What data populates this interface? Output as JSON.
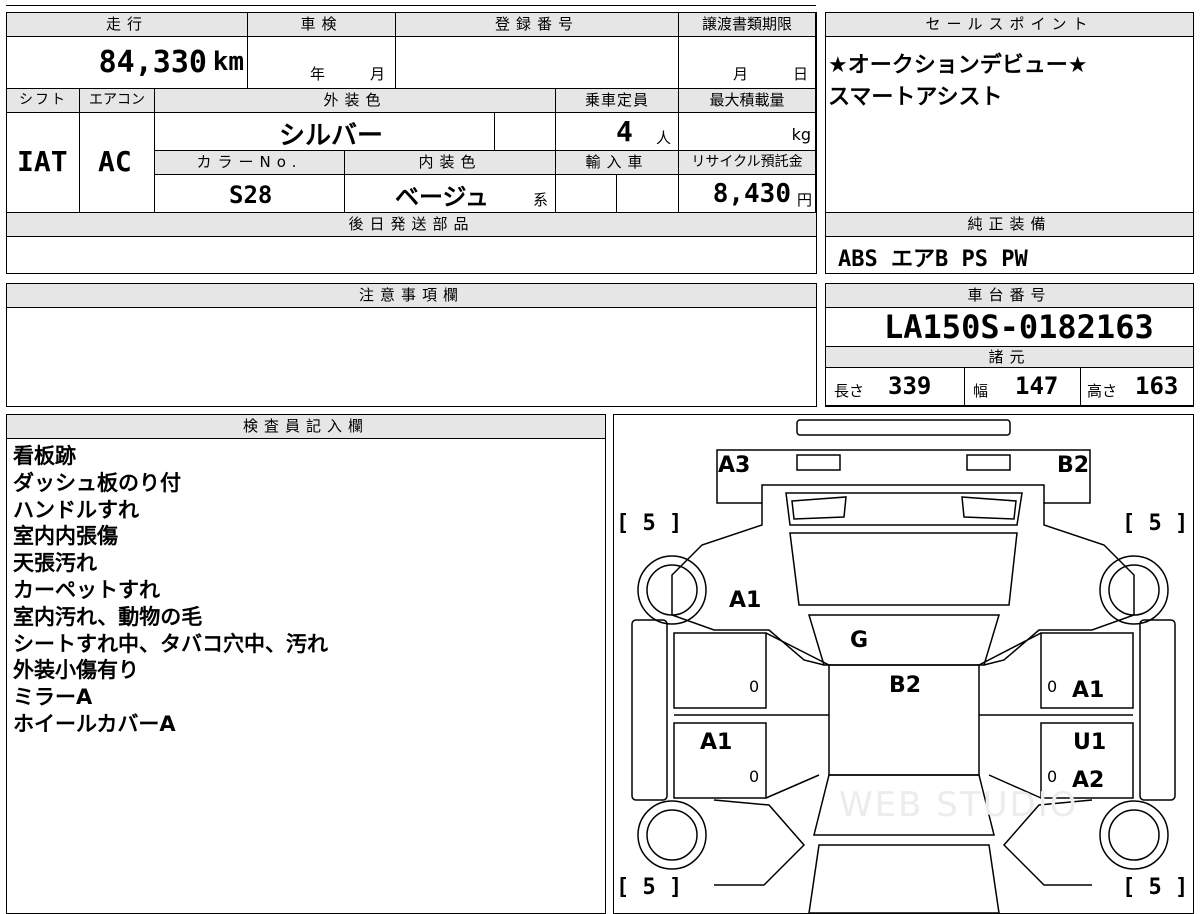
{
  "top_table": {
    "mileage": {
      "header": "走行",
      "value": "84,330",
      "unit": "km"
    },
    "inspection": {
      "header": "車検",
      "year_unit": "年",
      "month_unit": "月",
      "value": ""
    },
    "registration": {
      "header": "登録番号",
      "value": ""
    },
    "transfer_deadline": {
      "header": "譲渡書類期限",
      "month_unit": "月",
      "day_unit": "日",
      "value": ""
    },
    "shift": {
      "header": "シフト",
      "value": "IAT"
    },
    "aircon": {
      "header": "エアコン",
      "value": "AC"
    },
    "exterior_color": {
      "header": "外装色",
      "value": "シルバー"
    },
    "seating": {
      "header": "乗車定員",
      "value": "4",
      "unit": "人"
    },
    "max_load": {
      "header": "最大積載量",
      "value": "",
      "unit": "kg"
    },
    "color_no": {
      "header": "カラーNo.",
      "value": "S28"
    },
    "interior_color": {
      "header": "内装色",
      "value": "ベージュ",
      "suffix": "系"
    },
    "import": {
      "header": "輸入車",
      "value": ""
    },
    "recycle": {
      "header": "リサイクル預託金",
      "value": "8,430",
      "unit": "円"
    },
    "later_parts": {
      "header": "後日発送部品",
      "value": ""
    }
  },
  "sales_points": {
    "header": "セールスポイント",
    "lines": [
      "★オークションデビュー★",
      "スマートアシスト"
    ]
  },
  "genuine_equipment": {
    "header": "純正装備",
    "value": "ABS エアB PS PW"
  },
  "notes": {
    "header": "注意事項欄",
    "value": ""
  },
  "chassis": {
    "header": "車台番号",
    "value": "LA150S-0182163"
  },
  "specs": {
    "header": "諸元",
    "length": {
      "label": "長さ",
      "value": "339"
    },
    "width": {
      "label": "幅",
      "value": "147"
    },
    "height": {
      "label": "高さ",
      "value": "163"
    }
  },
  "inspector": {
    "header": "検査員記入欄",
    "lines": [
      "看板跡",
      "ダッシュ板のり付",
      "ハンドルすれ",
      "室内内張傷",
      "天張汚れ",
      "カーペットすれ",
      "室内汚れ、動物の毛",
      "シートすれ中、タバコ穴中、汚れ",
      "外装小傷有り",
      "ミラーA",
      "ホイールカバーA"
    ]
  },
  "diagram": {
    "labels": {
      "front_left": "A3",
      "front_right": "B2",
      "left_front_pillar": "A1",
      "windshield": "G",
      "roof": "B2",
      "left_front_door": "A1",
      "right_front_door": "A1",
      "right_rear_upper": "U1",
      "right_rear_lower": "A2",
      "door_zero_1": "0",
      "door_zero_2": "0",
      "door_zero_3": "0",
      "door_zero_4": "0"
    },
    "tread": {
      "fl": "[ 5 ]",
      "fr": "[ 5 ]",
      "rl": "[ 5 ]",
      "rr": "[ 5 ]"
    },
    "watermark": "WEB STUDIO"
  }
}
